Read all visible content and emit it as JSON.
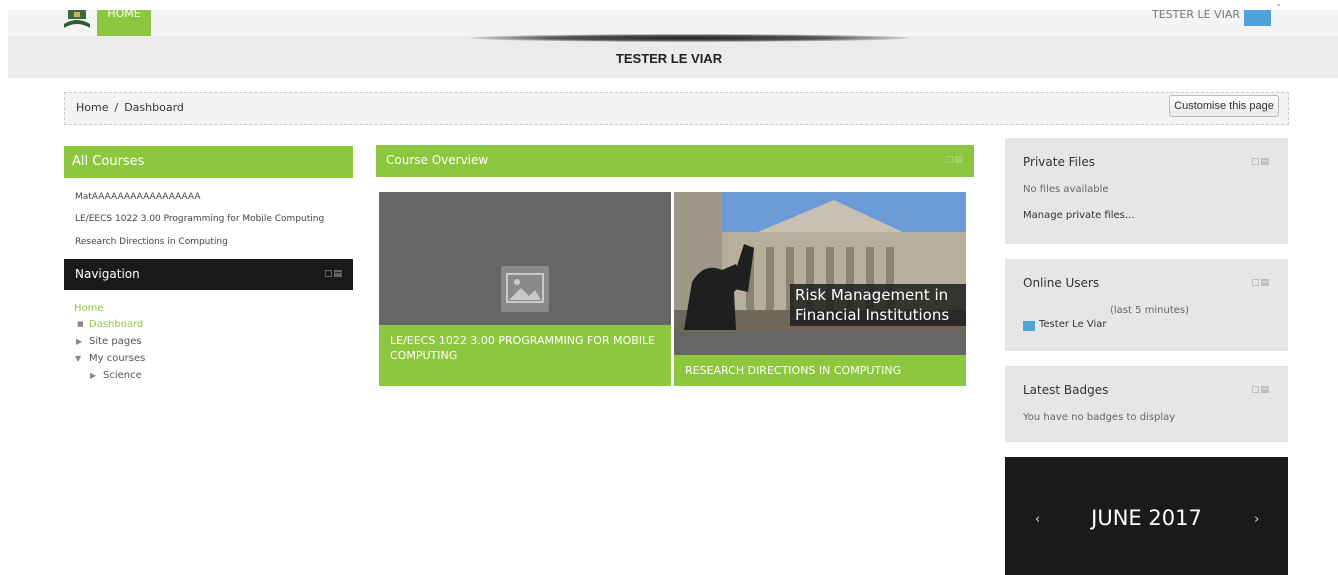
{
  "topbar": {
    "home_label": "HOME",
    "user_name": "TESTER LE VIAR",
    "caret": "ˇ"
  },
  "header": {
    "title": "TESTER LE VIAR"
  },
  "breadcrumb": {
    "items": [
      "Home",
      "Dashboard"
    ],
    "separator": "/"
  },
  "customise_label": "Customise this page",
  "all_courses": {
    "title": "All Courses",
    "courses": [
      "MatAAAAAAAAAAAAAAAAA",
      "LE/EECS 1022 3.00 Programming for Mobile Computing",
      "Research Directions in Computing"
    ]
  },
  "navigation": {
    "title": "Navigation",
    "home": "Home",
    "dashboard": "Dashboard",
    "site_pages": "Site pages",
    "my_courses": "My courses",
    "science": "Science"
  },
  "course_overview": {
    "title": "Course Overview",
    "cards": [
      {
        "caption": "LE/EECS 1022 3.00 PROGRAMMING FOR MOBILE COMPUTING"
      },
      {
        "image_title": "Risk Management in Financial Institutions",
        "caption": "RESEARCH DIRECTIONS IN COMPUTING"
      }
    ]
  },
  "private_files": {
    "title": "Private Files",
    "empty": "No files available",
    "manage": "Manage private files..."
  },
  "online_users": {
    "title": "Online Users",
    "period": "(last 5 minutes)",
    "users": [
      "Tester Le Viar"
    ]
  },
  "latest_badges": {
    "title": "Latest Badges",
    "empty": "You have no badges to display"
  },
  "calendar": {
    "month": "JUNE 2017",
    "prev": "‹",
    "next": "›"
  },
  "colors": {
    "accent": "#8dc63f",
    "dark": "#1a1a1a",
    "sidebar_bg": "#e6e6e6"
  }
}
